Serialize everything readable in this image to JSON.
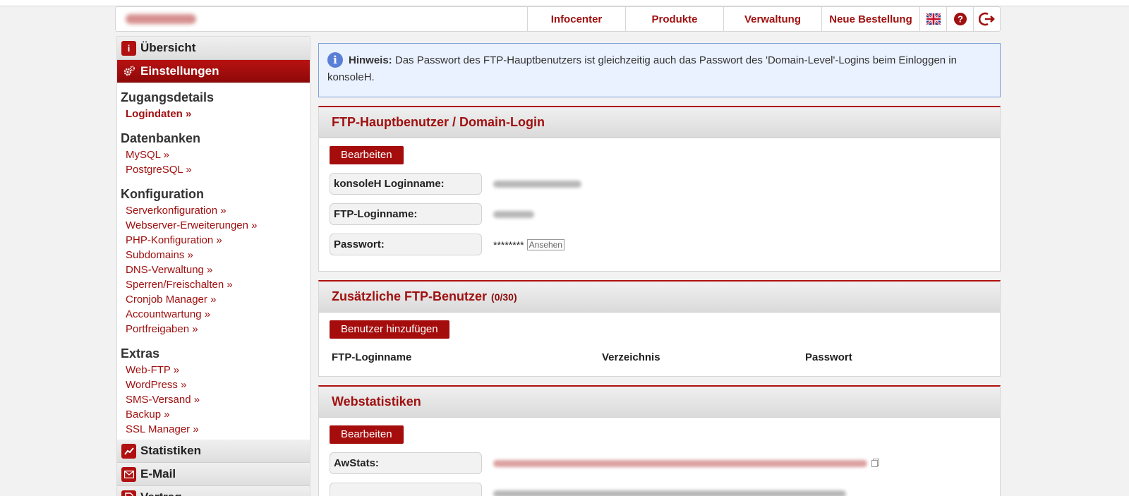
{
  "header": {
    "nav": [
      "Infocenter",
      "Produkte",
      "Verwaltung",
      "Neue Bestellung"
    ],
    "icons": [
      "uk-flag-icon",
      "help-icon",
      "logout-icon"
    ]
  },
  "sidebar": {
    "uebersicht": "Übersicht",
    "einstellungen": "Einstellungen",
    "groups": [
      {
        "title": "Zugangsdetails",
        "links": [
          "Logindaten »"
        ]
      },
      {
        "title": "Datenbanken",
        "links": [
          "MySQL »",
          "PostgreSQL »"
        ]
      },
      {
        "title": "Konfiguration",
        "links": [
          "Serverkonfiguration »",
          "Webserver-Erweiterungen »",
          "PHP-Konfiguration »",
          "Subdomains »",
          "DNS-Verwaltung »",
          "Sperren/Freischalten »",
          "Cronjob Manager »",
          "Accountwartung »",
          "Portfreigaben »"
        ]
      },
      {
        "title": "Extras",
        "links": [
          "Web-FTP »",
          "WordPress »",
          "SMS-Versand »",
          "Backup »",
          "SSL Manager »"
        ]
      }
    ],
    "statistiken": "Statistiken",
    "email": "E-Mail",
    "vertrag": "Vertrag"
  },
  "hint": {
    "title": "Hinweis:",
    "text": "Das Passwort des FTP-Hauptbenutzers ist gleichzeitig auch das Passwort des 'Domain-Level'-Logins beim Einloggen in konsoleH."
  },
  "ftp_main": {
    "title": "FTP-Hauptbenutzer / Domain-Login",
    "edit": "Bearbeiten",
    "login_label": "konsoleH Loginname:",
    "ftp_label": "FTP-Loginname:",
    "password_label": "Passwort:",
    "password_mask": "********",
    "show": "Ansehen"
  },
  "ftp_extra": {
    "title": "Zusätzliche FTP-Benutzer",
    "count": "(0/30)",
    "add": "Benutzer hinzufügen",
    "columns": [
      "FTP-Loginname",
      "Verzeichnis",
      "Passwort"
    ]
  },
  "webstats": {
    "title": "Webstatistiken",
    "edit": "Bearbeiten",
    "awstats_label": "AwStats:"
  },
  "colors": {
    "accent": "#a01010",
    "hint_bg": "#eaf1ff",
    "hint_border": "#7fa0d8"
  }
}
